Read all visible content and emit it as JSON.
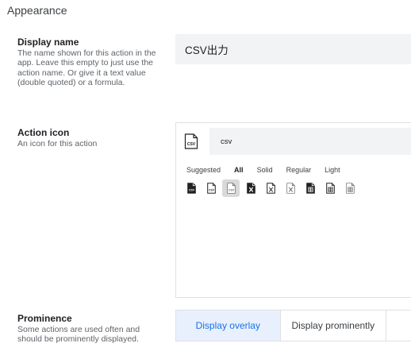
{
  "section": {
    "title": "Appearance"
  },
  "display_name": {
    "label": "Display name",
    "description": "The name shown for this action in the app. Leave this empty to just use the action name. Or give it a text value (double quoted) or a formula.",
    "value": "CSV出力"
  },
  "action_icon": {
    "label": "Action icon",
    "description": "An icon for this action",
    "search_value": "csv",
    "selected_icon": "file-csv-icon",
    "filter_tabs": [
      "Suggested",
      "All",
      "Solid",
      "Regular",
      "Light"
    ],
    "active_tab": "All",
    "icons": [
      "file-csv-solid-icon",
      "file-csv-regular-icon",
      "file-csv-light-icon",
      "file-excel-solid-icon",
      "file-excel-regular-icon",
      "file-excel-light-icon",
      "file-spreadsheet-solid-icon",
      "file-spreadsheet-regular-icon",
      "file-spreadsheet-light-icon"
    ],
    "selected_index": 2
  },
  "prominence": {
    "label": "Prominence",
    "description": "Some actions are used often and should be prominently displayed.",
    "options": [
      "Display overlay",
      "Display prominently"
    ],
    "active_option": "Display overlay"
  },
  "colors": {
    "field_bg": "#f1f3f4",
    "accent": "#1a73e8",
    "active_bg": "#e8f0fe"
  }
}
